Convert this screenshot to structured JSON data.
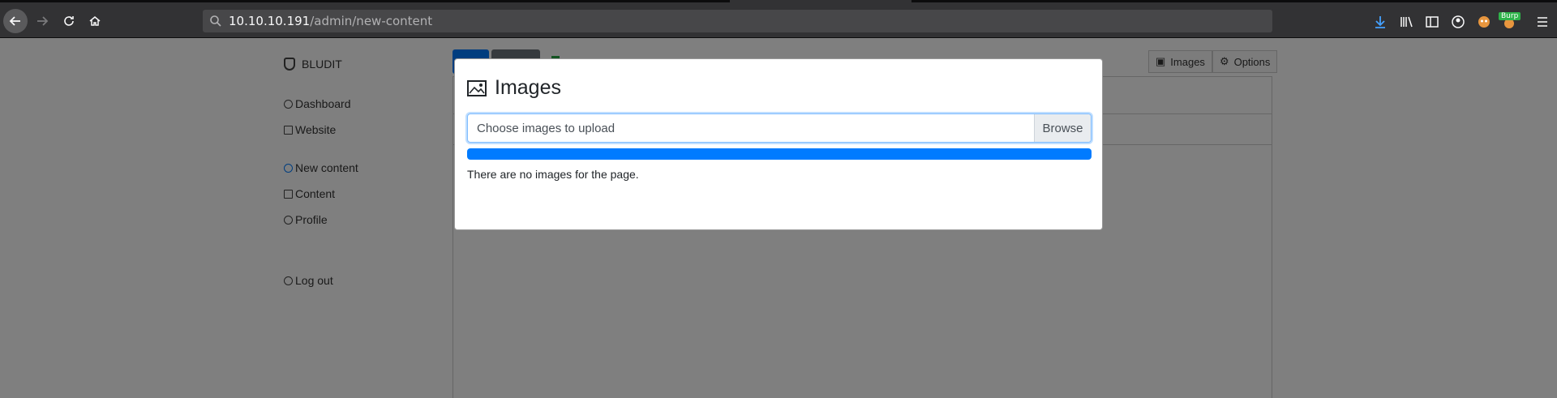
{
  "browser": {
    "url_host": "10.10.10.191",
    "url_path": "/admin/new-content",
    "burp_badge": "Burp"
  },
  "sidebar": {
    "brand": "BLUDIT",
    "items": [
      {
        "label": "Dashboard",
        "icon": "dashboard-icon"
      },
      {
        "label": "Website",
        "icon": "home-icon"
      },
      {
        "label": "New content",
        "icon": "plus-circle-icon"
      },
      {
        "label": "Content",
        "icon": "archive-icon"
      },
      {
        "label": "Profile",
        "icon": "user-icon"
      },
      {
        "label": "Log out",
        "icon": "logout-icon"
      }
    ]
  },
  "editor": {
    "images_button": "Images",
    "options_button": "Options"
  },
  "modal": {
    "title": "Images",
    "file_input_label": "Choose images to upload",
    "browse_label": "Browse",
    "progress_percent": 100,
    "empty_message": "There are no images for the page."
  },
  "colors": {
    "primary": "#007bff",
    "chrome_toolbar": "#323234",
    "url_bar": "#474749"
  }
}
